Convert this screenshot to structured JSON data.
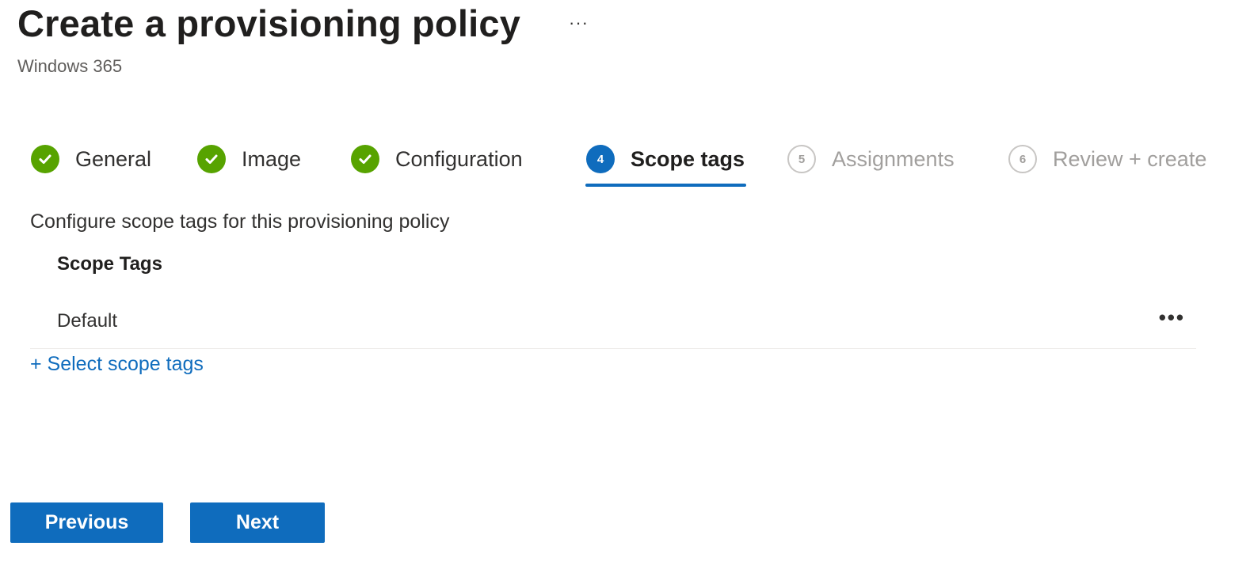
{
  "header": {
    "title": "Create a provisioning policy",
    "more_label": "···",
    "subtitle": "Windows 365"
  },
  "wizard": {
    "steps": [
      {
        "label": "General",
        "state": "completed",
        "icon": "check-circle-icon"
      },
      {
        "label": "Image",
        "state": "completed",
        "icon": "check-circle-icon"
      },
      {
        "label": "Configuration",
        "state": "completed",
        "icon": "check-circle-icon"
      },
      {
        "label": "Scope tags",
        "state": "current",
        "number": "4"
      },
      {
        "label": "Assignments",
        "state": "pending",
        "number": "5"
      },
      {
        "label": "Review + create",
        "state": "pending",
        "number": "6"
      }
    ]
  },
  "content": {
    "description": "Configure scope tags for this provisioning policy",
    "column_header": "Scope Tags",
    "rows": [
      {
        "name": "Default",
        "more_label": "•••"
      }
    ],
    "select_link": "+ Select scope tags"
  },
  "footer": {
    "previous_label": "Previous",
    "next_label": "Next"
  },
  "colors": {
    "accent": "#0f6cbd",
    "success": "#57a300",
    "pending": "#a19f9d"
  }
}
